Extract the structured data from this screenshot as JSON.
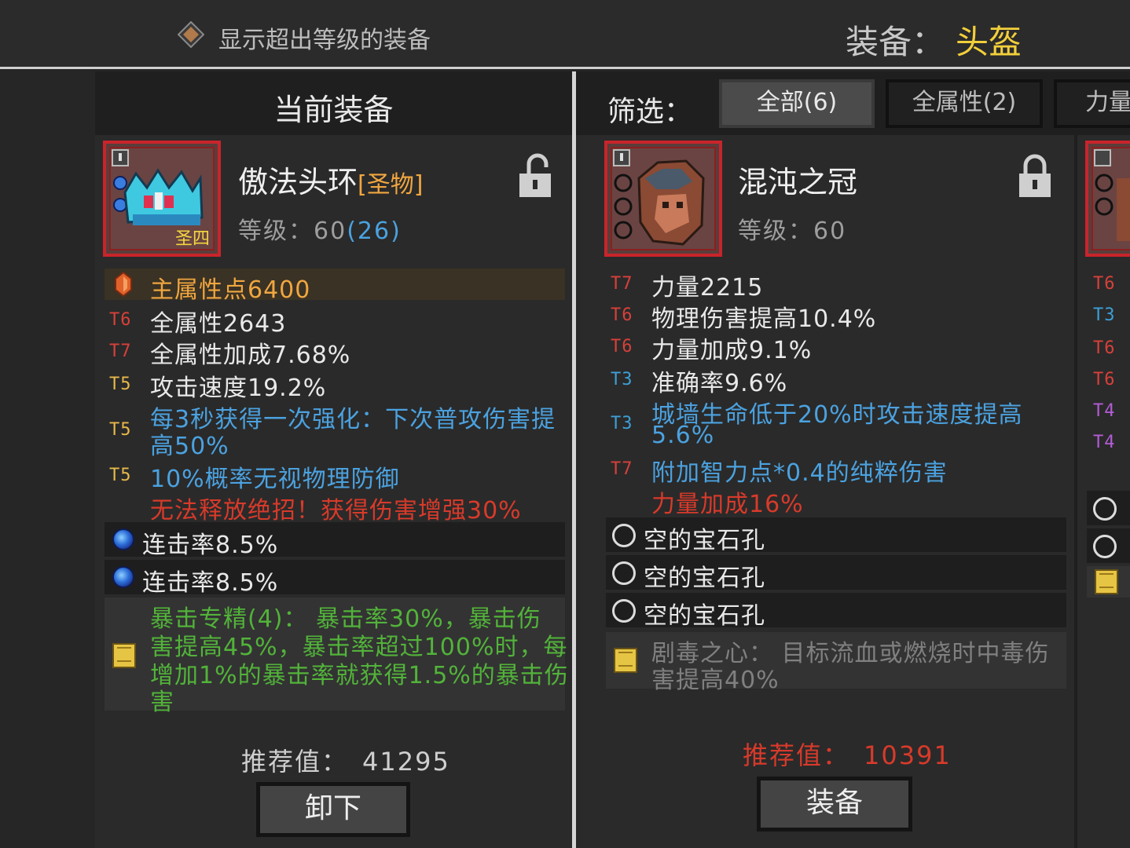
{
  "topbar": {
    "toggle_label": "显示超出等级的装备",
    "equip_title": "装备：",
    "equip_slot": "头盔"
  },
  "colors": {
    "gold": "#f2cf3b",
    "orange": "#f0a640",
    "red": "#d83a2a",
    "blue": "#4ba2e0",
    "green": "#52b33a",
    "tier_red": "#d8403a",
    "tier_gold": "#e8b84a",
    "tier_blue": "#3d9fd6",
    "tier_purple": "#b45cd6"
  },
  "current": {
    "header": "当前装备",
    "name": "傲法头环",
    "tag": "[圣物]",
    "level_label": "等级：60",
    "level_extra": "(26)",
    "badge": "圣四",
    "main_stat": "主属性点6400",
    "stats": [
      {
        "tier": "T6",
        "text": "全属性2643"
      },
      {
        "tier": "T7",
        "text": "全属性加成7.68%"
      },
      {
        "tier": "T5",
        "text": "攻击速度19.2%"
      },
      {
        "tier": "T5",
        "text": "每3秒获得一次强化：下次普攻伤害提",
        "text2": "高50%"
      },
      {
        "tier": "T5",
        "text": "10%概率无视物理防御"
      }
    ],
    "penalty": "无法释放绝招！获得伤害增强30%",
    "gems": [
      "连击率8.5%",
      "连击率8.5%"
    ],
    "set_lines": [
      "暴击专精(4)： 暴击率30%，暴击伤",
      "害提高45%，暴击率超过100%时，每",
      "增加1%的暴击率就获得1.5%的暴击伤",
      "害"
    ],
    "rec_label": "推荐值：",
    "rec_value": "41295",
    "button": "卸下"
  },
  "filter": {
    "label": "筛选：",
    "tabs": [
      "全部(6)",
      "全属性(2)",
      "力量"
    ]
  },
  "candidate": {
    "name": "混沌之冠",
    "level_label": "等级：60",
    "stats": [
      {
        "tier": "T7",
        "text": "力量2215"
      },
      {
        "tier": "T6",
        "text": "物理伤害提高10.4%"
      },
      {
        "tier": "T6",
        "text": "力量加成9.1%"
      },
      {
        "tier": "T3",
        "text": "准确率9.6%"
      },
      {
        "tier": "T3",
        "text": "城墙生命低于20%时攻击速度提高",
        "text2": "5.6%"
      },
      {
        "tier": "T7",
        "text": "附加智力点*0.4的纯粹伤害"
      }
    ],
    "extra": "力量加成16%",
    "gems": [
      "空的宝石孔",
      "空的宝石孔",
      "空的宝石孔"
    ],
    "set_lines": [
      "剧毒之心： 目标流血或燃烧时中毒伤",
      "害提高40%"
    ],
    "rec_label": "推荐值：",
    "rec_value": "10391",
    "button": "装备"
  },
  "peek": {
    "tiers": [
      "T6",
      "T3",
      "T6",
      "T6",
      "T4",
      "T4"
    ]
  }
}
